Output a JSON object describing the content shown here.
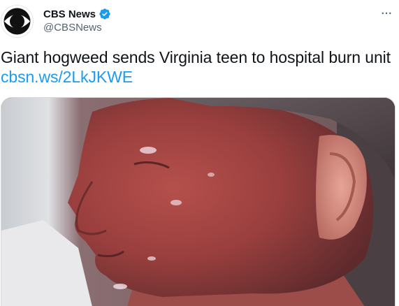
{
  "tweet": {
    "author": {
      "display_name": "CBS News",
      "handle": "@CBSNews",
      "verified": true,
      "avatar_icon": "cbs-eye-logo"
    },
    "more_icon": "more-horizontal-icon",
    "text": "Giant hogweed sends Virginia teen to hospital burn unit",
    "link": "cbsn.ws/2LkJKWE",
    "media": {
      "type": "photo",
      "alt": ""
    }
  },
  "colors": {
    "link": "#1d9bf0",
    "verified": "#1d9bf0",
    "secondary_text": "#536471",
    "primary_text": "#0f1419"
  }
}
